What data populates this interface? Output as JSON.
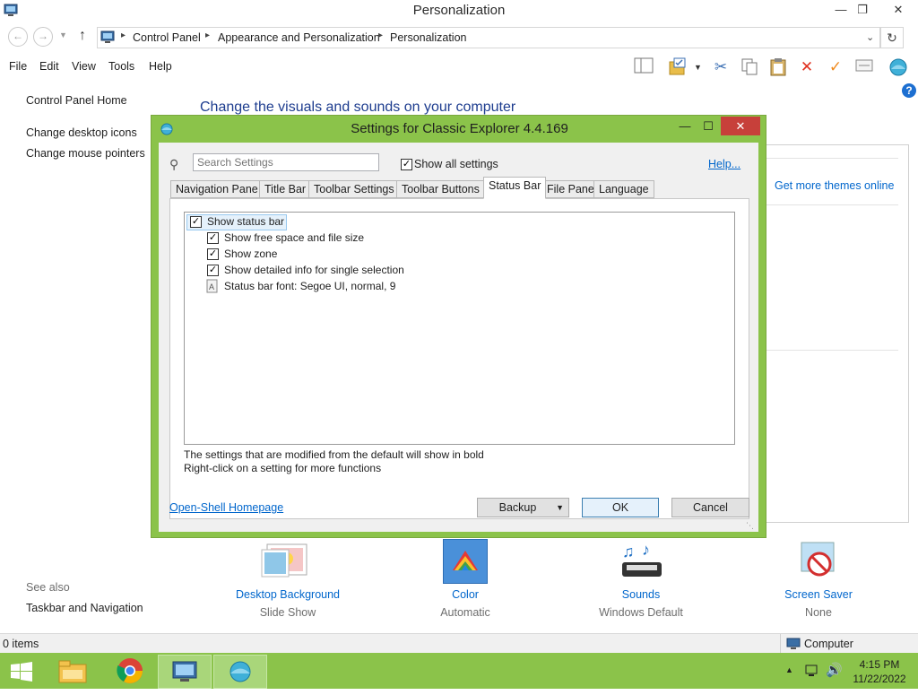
{
  "window": {
    "title": "Personalization"
  },
  "address": {
    "crumbs": [
      "Control Panel",
      "Appearance and Personalization",
      "Personalization"
    ]
  },
  "menu": {
    "file": "File",
    "edit": "Edit",
    "view": "View",
    "tools": "Tools",
    "help": "Help"
  },
  "sidebar": {
    "home": "Control Panel Home",
    "desktop_icons": "Change desktop icons",
    "mouse_pointers": "Change mouse pointers",
    "see_also": "See also",
    "taskbar_nav": "Taskbar and Navigation"
  },
  "main": {
    "heading": "Change the visuals and sounds on your computer",
    "get_more_themes": "Get more themes online"
  },
  "dialog": {
    "title": "Settings for Classic Explorer 4.4.169",
    "search_placeholder": "Search Settings",
    "show_all": "Show all settings",
    "help": "Help...",
    "tabs": [
      "Navigation Pane",
      "Title Bar",
      "Toolbar Settings",
      "Toolbar Buttons",
      "Status Bar",
      "File Pane",
      "Language"
    ],
    "active_tab": "Status Bar",
    "settings": {
      "show_status_bar": "Show status bar",
      "free_space": "Show free space and file size",
      "zone": "Show zone",
      "detailed_info": "Show detailed info for single selection",
      "font": "Status bar font: Segoe UI, normal, 9"
    },
    "note1": "The settings that are modified from the default will show in bold",
    "note2": "Right-click on a setting for more functions",
    "homepage": "Open-Shell Homepage",
    "backup": "Backup",
    "ok": "OK",
    "cancel": "Cancel"
  },
  "themes": [
    {
      "label": "Desktop Background",
      "sub": "Slide Show",
      "icon": "desktop-background-icon"
    },
    {
      "label": "Color",
      "sub": "Automatic",
      "icon": "color-icon"
    },
    {
      "label": "Sounds",
      "sub": "Windows Default",
      "icon": "sounds-icon"
    },
    {
      "label": "Screen Saver",
      "sub": "None",
      "icon": "screen-saver-icon"
    }
  ],
  "status": {
    "items": "0 items",
    "computer": "Computer"
  },
  "clock": {
    "time": "4:15 PM",
    "date": "11/22/2022"
  },
  "colors": {
    "accent": "#8bc34a",
    "link": "#0066cc"
  }
}
